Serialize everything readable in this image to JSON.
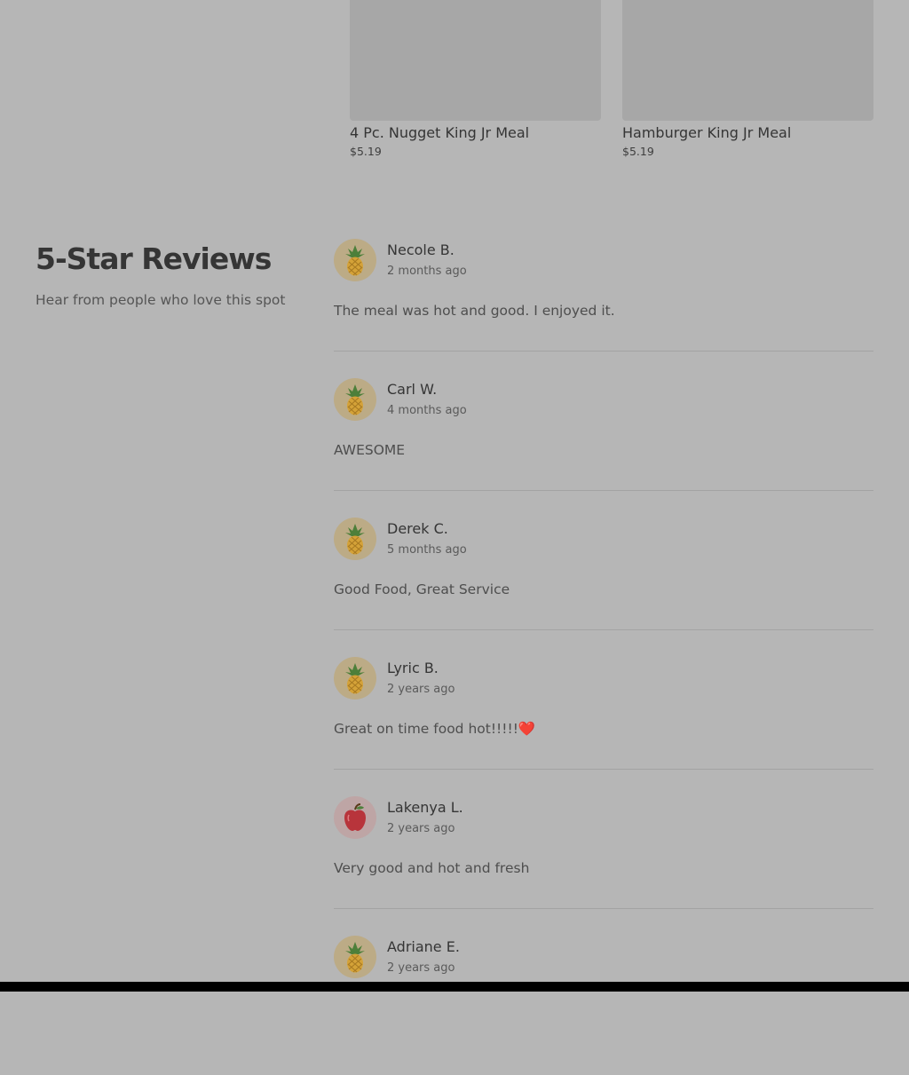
{
  "menu_items": [
    {
      "name": "4 Pc. Nugget King Jr Meal",
      "price": "$5.19"
    },
    {
      "name": "Hamburger King Jr Meal",
      "price": "$5.19"
    }
  ],
  "reviews_section": {
    "title": "5-Star Reviews",
    "subtitle": "Hear from people who love this spot"
  },
  "reviews": [
    {
      "name": "Necole B.",
      "date": "2 months ago",
      "text": "The meal was hot and good. I enjoyed it.",
      "avatar_icon": "pineapple-icon"
    },
    {
      "name": "Carl W.",
      "date": "4 months ago",
      "text": "AWESOME",
      "avatar_icon": "pineapple-icon"
    },
    {
      "name": "Derek C.",
      "date": "5 months ago",
      "text": "Good Food, Great Service",
      "avatar_icon": "pineapple-icon"
    },
    {
      "name": "Lyric B.",
      "date": "2 years ago",
      "text": "Great on time food hot!!!!!❤️",
      "avatar_icon": "pineapple-icon"
    },
    {
      "name": "Lakenya L.",
      "date": "2 years ago",
      "text": "Very good and hot and fresh",
      "avatar_icon": "apple-icon"
    },
    {
      "name": "Adriane E.",
      "date": "2 years ago",
      "text": "",
      "avatar_icon": "pineapple-icon"
    }
  ],
  "colors": {
    "overlay_background": "#b6b6b6",
    "text_primary": "#353535",
    "pineapple_avatar_bg": "#bcab86",
    "apple_avatar_bg": "#bea5a5"
  }
}
